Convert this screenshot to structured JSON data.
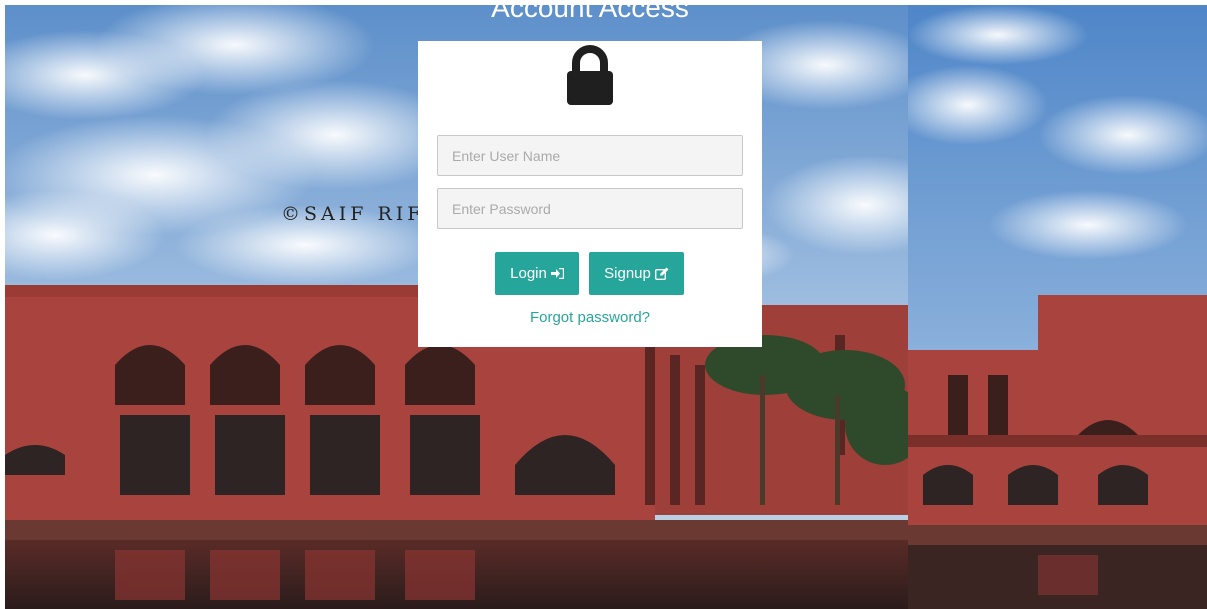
{
  "page": {
    "title": "Account Access"
  },
  "background": {
    "watermark": "©SAIF RIFA"
  },
  "login_form": {
    "username_placeholder": "Enter User Name",
    "password_placeholder": "Enter Password",
    "login_label": "Login",
    "signup_label": "Signup",
    "forgot_label": "Forgot password?",
    "lock_icon": "lock-icon",
    "login_icon": "sign-in-icon",
    "signup_icon": "edit-icon"
  },
  "colors": {
    "accent": "#26a69a",
    "card": "#ffffff",
    "sky": "#6f9ed4",
    "brick": "#a8433e",
    "water": "#3a2523"
  }
}
